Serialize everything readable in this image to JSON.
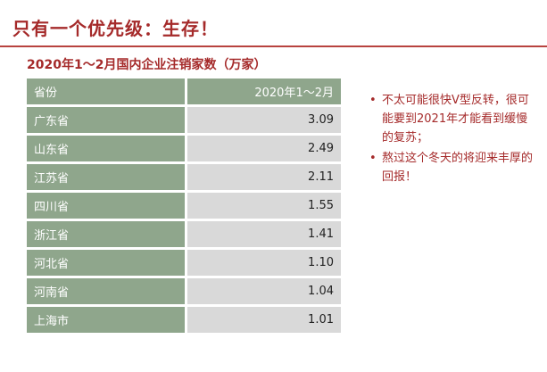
{
  "slide": {
    "title": "只有一个优先级：生存！"
  },
  "table": {
    "caption": "2020年1～2月国内企业注销家数（万家）",
    "headers": [
      "省份",
      "2020年1～2月"
    ],
    "rows": [
      {
        "province": "广东省",
        "value": "3.09"
      },
      {
        "province": "山东省",
        "value": "2.49"
      },
      {
        "province": "江苏省",
        "value": "2.11"
      },
      {
        "province": "四川省",
        "value": "1.55"
      },
      {
        "province": "浙江省",
        "value": "1.41"
      },
      {
        "province": "河北省",
        "value": "1.10"
      },
      {
        "province": "河南省",
        "value": "1.04"
      },
      {
        "province": "上海市",
        "value": "1.01"
      }
    ]
  },
  "notes": {
    "bullet_symbol": "•",
    "items": [
      "不太可能很快V型反转，很可能要到2021年才能看到缓慢的复苏；",
      "熬过这个冬天的将迎来丰厚的回报！"
    ]
  },
  "colors": {
    "accent": "#a52a2a",
    "table_green": "#8fa68c",
    "table_gray": "#d9d9d9"
  }
}
